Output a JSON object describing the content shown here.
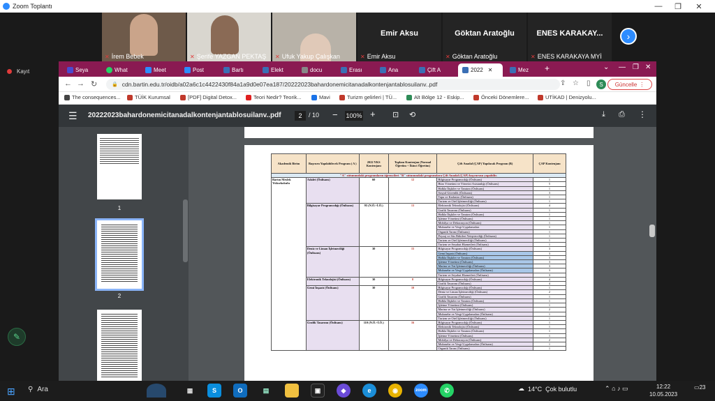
{
  "zoom": {
    "title": "Zoom Toplantı",
    "recording_label": "Kayıt",
    "participants": [
      {
        "name": "İrem Bebek",
        "muted": true,
        "video": true
      },
      {
        "name": "Şerife YAZGAN PEKTAŞ",
        "muted": true,
        "video": true
      },
      {
        "name": "Ufuk Yakup Çalışkan",
        "muted": true,
        "video": true
      },
      {
        "name": "Emir Aksu",
        "muted": true,
        "video": false,
        "display": "Emir Aksu"
      },
      {
        "name": "Göktan Aratoğlu",
        "muted": true,
        "video": false,
        "display": "Göktan Aratoğlu"
      },
      {
        "name": "ENES KARAKAYA MYİ",
        "muted": true,
        "video": false,
        "display": "ENES KARAKAY..."
      }
    ],
    "next_arrow": "›"
  },
  "browser": {
    "tabs": [
      {
        "label": "Seya",
        "color": "#4a4ad0"
      },
      {
        "label": "What",
        "color": "#25d366"
      },
      {
        "label": "Meet",
        "color": "#2d8cff"
      },
      {
        "label": "Post",
        "color": "#2d8cff"
      },
      {
        "label": "Bartı",
        "color": "#3a6fb5"
      },
      {
        "label": "Elekt",
        "color": "#3a6fb5"
      },
      {
        "label": "docu",
        "color": "#888888"
      },
      {
        "label": "Erası",
        "color": "#3a6fb5"
      },
      {
        "label": "Ana",
        "color": "#3a6fb5"
      },
      {
        "label": "Çift A",
        "color": "#3a6fb5"
      },
      {
        "label": "2022",
        "color": "#3a6fb5",
        "active": true
      },
      {
        "label": "Mez",
        "color": "#3a6fb5"
      }
    ],
    "url": "cdn.bartin.edu.tr/oidb/a02a6c1c4422430f84a1a9d0e07ea187/20222023bahardonemicitanadalkontenjantablosuilanv..pdf",
    "update_label": "Güncelle",
    "profile_initial": "S",
    "bookmarks": [
      {
        "label": "The consequences...",
        "color": "#444444"
      },
      {
        "label": "TÜİK Kurumsal",
        "color": "#c0392b"
      },
      {
        "label": "[PDF] Digital Detox...",
        "color": "#c0392b"
      },
      {
        "label": "Teori Nedir? Teorik...",
        "color": "#e02020"
      },
      {
        "label": "Mavi",
        "color": "#1a73e8"
      },
      {
        "label": "Turizm gelirleri | TÜ...",
        "color": "#c0392b"
      },
      {
        "label": "Alt Bölge 12 - Eskip...",
        "color": "#2e8b57"
      },
      {
        "label": "Önceki Dönemlere...",
        "color": "#c0392b"
      },
      {
        "label": "UTİKAD | Denizyolu...",
        "color": "#c0392b"
      }
    ]
  },
  "pdf": {
    "filename": "20222023bahardonemicitanadalkontenjantablosuilanv..pdf",
    "current_page": "2",
    "total_pages": "/ 10",
    "zoom": "100%",
    "thumbnails": [
      "1",
      "2"
    ]
  },
  "table": {
    "headers": [
      "Akademik Birim",
      "Başvuru Yapılabilecek Program ( A )",
      "2022 YKS Kontenjanı",
      "Toplam Kontenjan (Normal Öğretim + İkinci Öğretim)",
      "Çift Anadal (ÇAP) Yapılacak Program (B)",
      "ÇAP Kontenjanı"
    ],
    "banner": "\"A\" sütunundaki programların öğrencileri \"B\" sütunundaki programlara Çift Anadal (ÇAP) başvurusu yapabilir.",
    "unit": "Bartın Meslek Yüksekokulu",
    "groups": [
      {
        "program": "Adalet (Önlisans)",
        "yks": "60",
        "total": "12",
        "rows": [
          [
            "Bilgisayar Programcılığı (Önlisans)",
            "1"
          ],
          [
            "Büro Yönetimi ve Yönetici Asistanlığı (Önlisans)",
            "5"
          ],
          [
            "Halkla İlişkiler ve Tanıtım (Önlisans)",
            "1"
          ],
          [
            "Sosyal Güvenlik (Önlisans)",
            "3"
          ],
          [
            "Tapu ve Kadastro (Önlisans)",
            "1"
          ],
          [
            "Turizm ve Otel İşletmeciliği (Önlisans)",
            "1"
          ]
        ]
      },
      {
        "program": "Bilgisayar Programcılığı (Önlisans)",
        "yks": "95 (N.Ö.+İ.Ö.)",
        "total": "13",
        "rows": [
          [
            "Elektronik Teknolojisi (Önlisans)",
            "4"
          ],
          [
            "Grafik Tasarımı (Önlisans)",
            "1"
          ],
          [
            "Halkla İlişkiler ve Tanıtım (Önlisans)",
            "1"
          ],
          [
            "İşletme Yönetimi (Önlisans)",
            "1"
          ],
          [
            "Mobilya ve Dekorasyon (Önlisans)",
            "1"
          ],
          [
            "Muhasebe ve Vergi Uygulamaları",
            "1"
          ],
          [
            "Organik Tarım (Önlisans)",
            "1"
          ],
          [
            "Peyzaj ve Süs Bitkileri Yetiştiriciliği (Önlisans)",
            "1"
          ],
          [
            "Turizm ve Otel İşletmeciliği (Önlisans)",
            "1"
          ],
          [
            "Turizm ve Seyahat Hizmetleri (Önlisans)",
            "1"
          ]
        ]
      },
      {
        "program": "Deniz ve Liman İşletmeciliği (Önlisans)",
        "yks": "30",
        "total": "15",
        "rows": [
          [
            "Bilgisayar Programcılığı (Önlisans)",
            "3"
          ],
          [
            "Gemi İnşaatı (Önlisans)",
            "3"
          ],
          [
            "Halkla İlişkiler ve Tanıtım (Önlisans)",
            "3"
          ],
          [
            "İşletme Yönetimi (Önlisans)",
            "3"
          ],
          [
            "Marina ve Yat İşletmeciliği (Önlisans)",
            "3"
          ],
          [
            "Muhasebe ve Vergi Uygulamaları (Önlisans)",
            "3"
          ],
          [
            "Turizm ve Seyahat Hizmetleri (Önlisans)",
            "3"
          ]
        ]
      },
      {
        "program": "Elektronik Teknolojisi (Önlisans)",
        "yks": "30",
        "total": "8",
        "rows": [
          [
            "Bilgisayar Programcılığı (Önlisans)",
            "4"
          ],
          [
            "Grafik Tasarımı (Önlisans)",
            "4"
          ]
        ]
      },
      {
        "program": "Gemi İnşaatı (Önlisans)",
        "yks": "30",
        "total": "10",
        "rows": [
          [
            "Bilgisayar Programcılığı (Önlisans)",
            "1"
          ],
          [
            "Deniz ve Liman İşletmeciliği (Önlisans)",
            "2"
          ],
          [
            "Grafik Tasarımı (Önlisans)",
            "1"
          ],
          [
            "Halkla İlişkiler ve Tanıtım (Önlisans)",
            "1"
          ],
          [
            "İşletme Yönetimi (Önlisans)",
            "1"
          ],
          [
            "Marina ve Yat İşletmeciliği (Önlisans)",
            "2"
          ],
          [
            "Muhasebe ve Vergi Uygulamaları (Önlisans)",
            "1"
          ],
          [
            "Turizm ve Otel İşletmeciliği (Önlisans)",
            "1"
          ]
        ]
      },
      {
        "program": "Grafik Tasarımı (Önlisans)",
        "yks": "110 (N.Ö.+İ.Ö.)",
        "total": "16",
        "rows": [
          [
            "Bilgisayar Programcılığı (Önlisans)",
            "1"
          ],
          [
            "Elektronik Teknolojisi (Önlisans)",
            "1"
          ],
          [
            "Halkla İlişkiler ve Tanıtım (Önlisans)",
            "1"
          ],
          [
            "İşletme Yönetimi (Önlisans)",
            "1"
          ],
          [
            "Mobilya ve Dekorasyon (Önlisans)",
            "2"
          ],
          [
            "Muhasebe ve Vergi Uygulamaları (Önlisans)",
            "1"
          ],
          [
            "Organik Tarım (Önlisans)",
            "1"
          ]
        ]
      }
    ]
  },
  "taskbar": {
    "search_label": "Ara",
    "weather_temp": "14°C",
    "weather_desc": "Çok bulutlu",
    "time": "12:22",
    "date": "10.05.2023",
    "notif_count": "23"
  }
}
